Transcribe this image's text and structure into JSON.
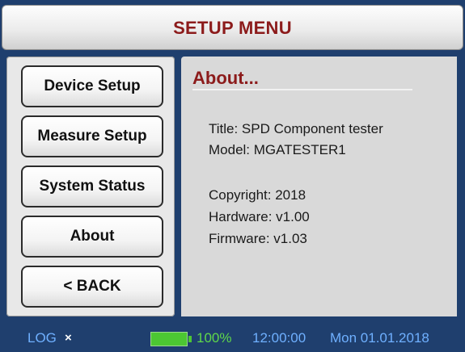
{
  "header": {
    "title": "SETUP MENU"
  },
  "sidebar": {
    "items": [
      {
        "label": "Device Setup"
      },
      {
        "label": "Measure Setup"
      },
      {
        "label": "System Status"
      },
      {
        "label": "About"
      },
      {
        "label": "< BACK"
      }
    ]
  },
  "content": {
    "heading": "About...",
    "title_line": "Title: SPD Component tester",
    "model_line": "Model: MGATESTER1",
    "copyright_line": "Copyright: 2018",
    "hardware_line": "Hardware: v1.00",
    "firmware_line": "Firmware: v1.03"
  },
  "status": {
    "log_label": "LOG",
    "log_close_icon": "close-icon",
    "battery_level": "100%",
    "battery_level_fraction": 1.0,
    "time": "12:00:00",
    "date": "Mon 01.01.2018",
    "colors": {
      "accent_red": "#8c1b1b",
      "status_text_blue": "#6fb0ff",
      "battery_green": "#4cc733",
      "battery_text_green": "#5fd84a",
      "status_bar_bg": "#1f3f6e"
    }
  }
}
